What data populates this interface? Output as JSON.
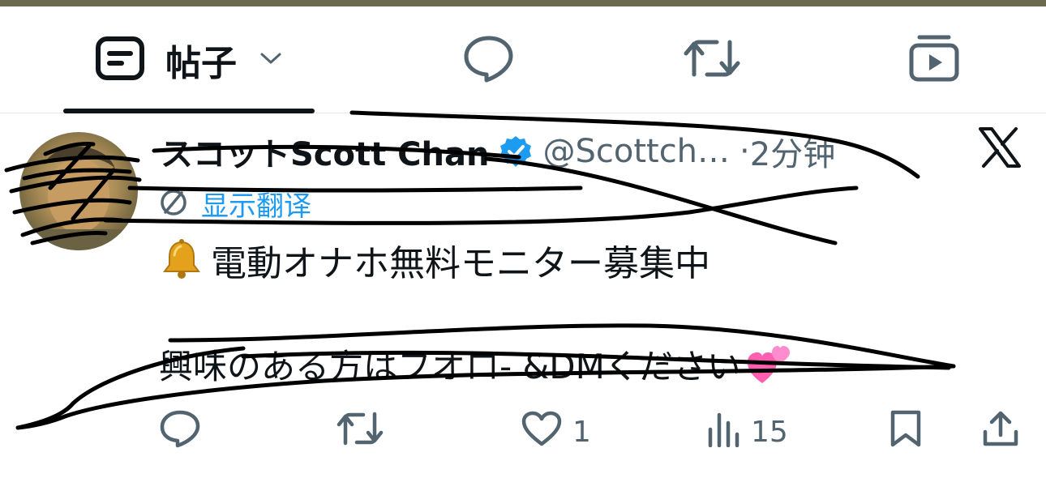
{
  "tabs": {
    "posts_label": "帖子"
  },
  "tweet": {
    "display_name": "スコットScott Chan",
    "handle": "@Scottch…",
    "separator": "·",
    "time": "2分钟",
    "translate_label": "显示翻译",
    "line1": "電動オナホ無料モニター募集中",
    "line2": "興味のある方はフオロ- &DMください"
  },
  "actions": {
    "likes": "1",
    "views": "15"
  },
  "colors": {
    "accent": "#1d9bf0",
    "text": "#0f1419",
    "muted": "#536471"
  }
}
